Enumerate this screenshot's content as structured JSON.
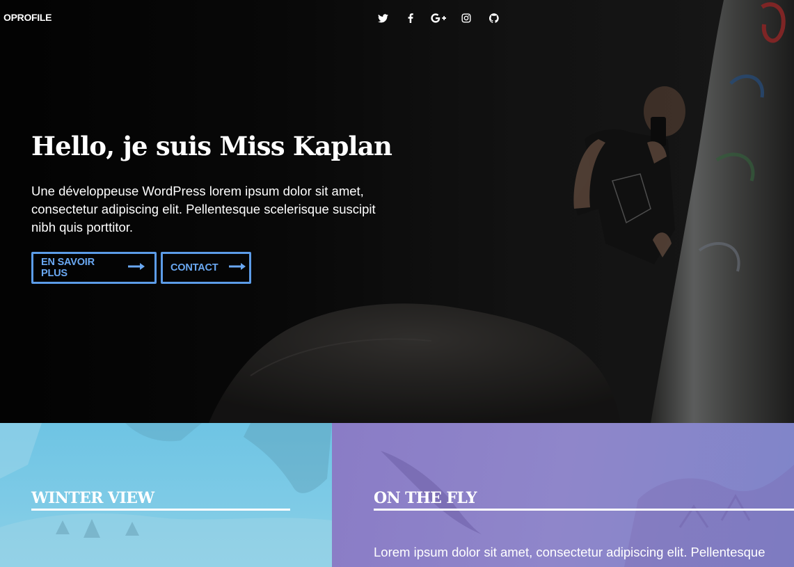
{
  "header": {
    "logo": "OPROFILE",
    "social": [
      {
        "icon": "twitter-icon"
      },
      {
        "icon": "facebook-icon"
      },
      {
        "icon": "google-plus-icon"
      },
      {
        "icon": "instagram-icon"
      },
      {
        "icon": "github-icon"
      }
    ]
  },
  "hero": {
    "title": "Hello, je suis Miss Kaplan",
    "description": "Une développeuse WordPress lorem ipsum dolor sit amet, consectetur adipiscing elit. Pellentesque scelerisque suscipit nibh quis porttitor.",
    "buttons": {
      "learn_more": "EN SAVOIR PLUS",
      "contact": "CONTACT"
    }
  },
  "panels": [
    {
      "title": "WINTER VIEW"
    },
    {
      "title": "ON THE FLY",
      "text": "Lorem ipsum dolor sit amet, consectetur adipiscing elit. Pellentesque"
    }
  ],
  "colors": {
    "accent": "#5c9ce8",
    "panel_left": "#7fcbe6",
    "panel_right": "#8a7cc6"
  }
}
